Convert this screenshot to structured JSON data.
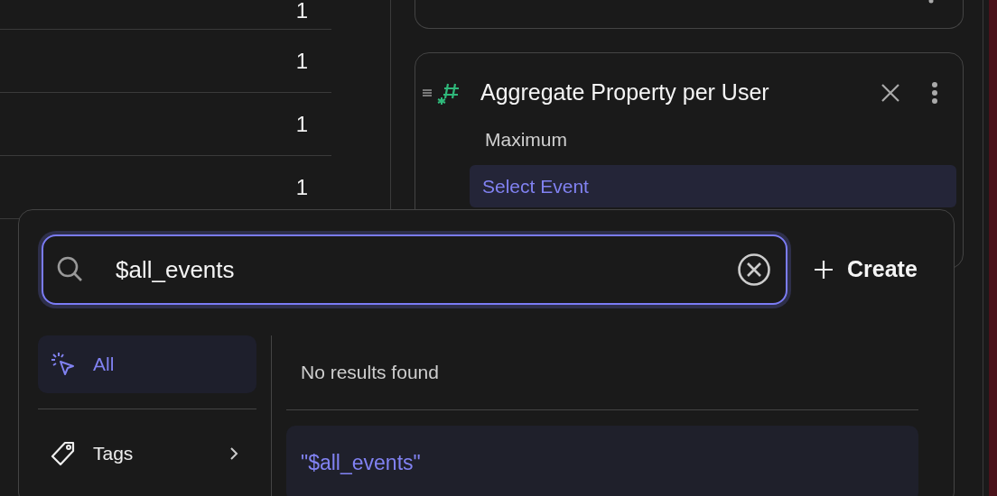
{
  "table": {
    "rows": [
      {
        "value": "1"
      },
      {
        "value": "1"
      },
      {
        "value": "1"
      },
      {
        "value": "1"
      }
    ]
  },
  "metric_card": {
    "title": "Aggregate Property per User",
    "aggregation": "Maximum",
    "event_selector": "Select Event"
  },
  "search_popover": {
    "search": {
      "value": "$all_events"
    },
    "create_button": "Create",
    "categories": [
      {
        "label": "All",
        "kind": "all",
        "selected": true
      },
      {
        "label": "Tags",
        "kind": "tags",
        "selected": false
      }
    ],
    "message": "No results found",
    "results": [
      {
        "label": "\"$all_events\""
      }
    ]
  }
}
